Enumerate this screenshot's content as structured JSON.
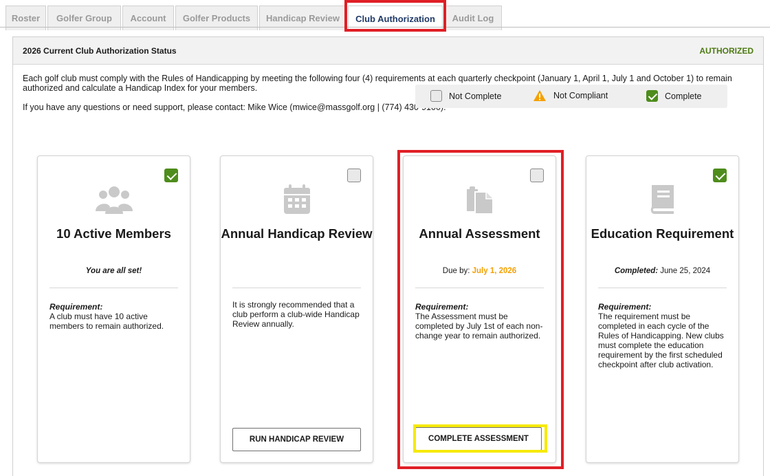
{
  "tabs": [
    {
      "label": "Roster"
    },
    {
      "label": "Golfer Group"
    },
    {
      "label": "Account"
    },
    {
      "label": "Golfer Products"
    },
    {
      "label": "Handicap Review"
    },
    {
      "label": "Club Authorization"
    },
    {
      "label": "Audit Log"
    }
  ],
  "panel": {
    "title": "2026 Current Club Authorization Status",
    "status": "AUTHORIZED",
    "intro": "Each golf club must comply with the Rules of Handicapping by meeting the following four (4) requirements at each quarterly checkpoint (January 1, April 1, July 1 and October 1) to remain authorized and calculate a Handicap Index for your members.",
    "contact": "If you have any questions or need support, please contact: Mike Wice (mwice@massgolf.org | (774) 430-9100)."
  },
  "legend": {
    "not_complete": "Not Complete",
    "not_compliant": "Not Compliant",
    "complete": "Complete"
  },
  "cards": [
    {
      "title": "10 Active Members",
      "subtitle": "You are all set!",
      "requirement_label": "Requirement:",
      "requirement": "A club must have 10 active members to remain authorized.",
      "icon": "users-icon",
      "checked": true
    },
    {
      "title": "Annual Handicap Review",
      "requirement": "It is strongly recommended that a club perform a club-wide Handicap Review annually.",
      "button": "RUN HANDICAP REVIEW",
      "icon": "calendar-icon",
      "checked": false
    },
    {
      "title": "Annual Assessment",
      "due_label": "Due by:",
      "due_date": "July 1, 2026",
      "requirement_label": "Requirement:",
      "requirement": "The Assessment must be completed by July 1st of each non-change year to remain authorized.",
      "button": "COMPLETE ASSESSMENT",
      "icon": "clipboard-icon",
      "checked": false
    },
    {
      "title": "Education Requirement",
      "completed_label": "Completed:",
      "completed_date": "June 25, 2024",
      "requirement_label": "Requirement:",
      "requirement": "The requirement must be completed in each cycle of the Rules of Handicapping. New clubs must complete the education requirement by the first scheduled checkpoint after club activation.",
      "icon": "book-icon",
      "checked": true
    }
  ],
  "colors": {
    "authorized": "#4d7b12",
    "check": "#4e8c1c",
    "due": "#f5a000",
    "highlight_red": "#e01f26",
    "highlight_yellow": "#f7ea00"
  }
}
